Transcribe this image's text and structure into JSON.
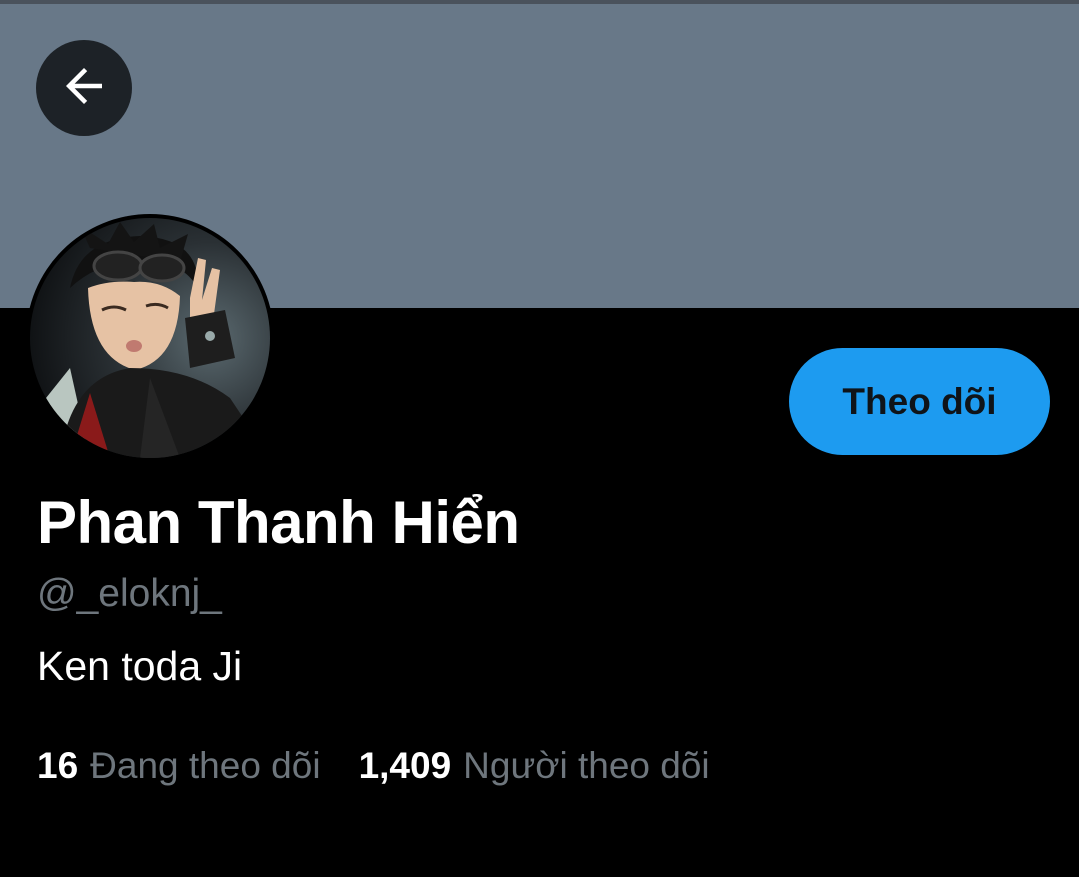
{
  "profile": {
    "name": "Phan Thanh Hiển",
    "handle": "@_eloknj_",
    "bio": "Ken toda Ji"
  },
  "actions": {
    "follow_label": "Theo dõi"
  },
  "stats": {
    "following_count": "16",
    "following_label": "Đang theo dõi",
    "followers_count": "1,409",
    "followers_label": "Người theo dõi"
  },
  "colors": {
    "banner": "#687888",
    "follow_button": "#1d9bf0",
    "secondary_text": "#6e767d",
    "background": "#000000"
  },
  "icons": {
    "back": "arrow-left-icon"
  }
}
